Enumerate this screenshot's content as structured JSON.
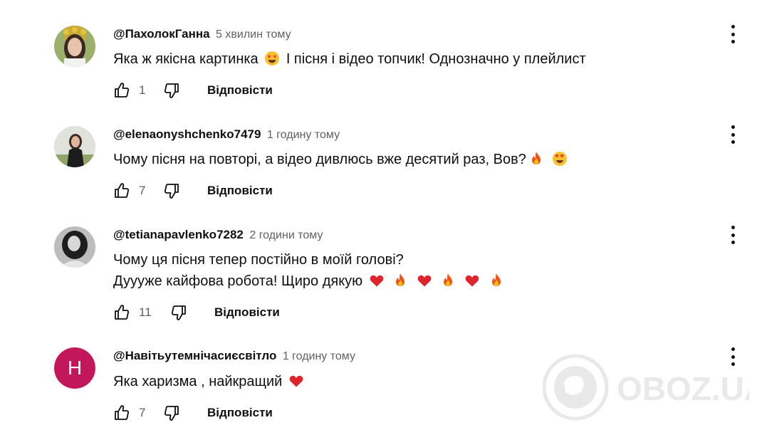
{
  "comments": [
    {
      "author": "@ПахолокГанна",
      "time": "5 хвилин тому",
      "lines": [
        "Яка ж якісна картинка",
        "І пісня і відео топчик! Однозначно у плейлист"
      ],
      "likes": "1",
      "reply": "Відповісти",
      "avatar": "photo-woman-flower-crown"
    },
    {
      "author": "@elenaonyshchenko7479",
      "time": "1 годину тому",
      "lines": [
        "Чому пісня на повторі, а відео дивлюсь вже десятий раз, Вов?"
      ],
      "likes": "7",
      "reply": "Відповісти",
      "avatar": "photo-woman-dark-outfit"
    },
    {
      "author": "@tetianapavlenko7282",
      "time": "2 години тому",
      "lines": [
        "Чому ця пісня тепер постійно в моїй голові?",
        "Дуууже кайфова робота! Щиро дякую"
      ],
      "likes": "11",
      "reply": "Відповісти",
      "avatar": "photo-woman-bw"
    },
    {
      "author": "@Навітьутемнічасиєсвітло",
      "time": "1 годину тому",
      "lines": [
        "Яка харизма , найкращий"
      ],
      "likes": "7",
      "reply": "Відповісти",
      "avatar_letter": "Н",
      "avatar_color": "#c2185b"
    }
  ],
  "icons": {
    "like": "thumbs-up-icon",
    "dislike": "thumbs-down-icon",
    "menu": "more-vertical-icon",
    "emoji_star_eyes": "star-struck-emoji",
    "emoji_fire": "fire-emoji",
    "emoji_heart_eyes": "heart-eyes-emoji",
    "emoji_heart": "red-heart-emoji"
  },
  "watermark": {
    "text": "OBOZ.UA"
  }
}
